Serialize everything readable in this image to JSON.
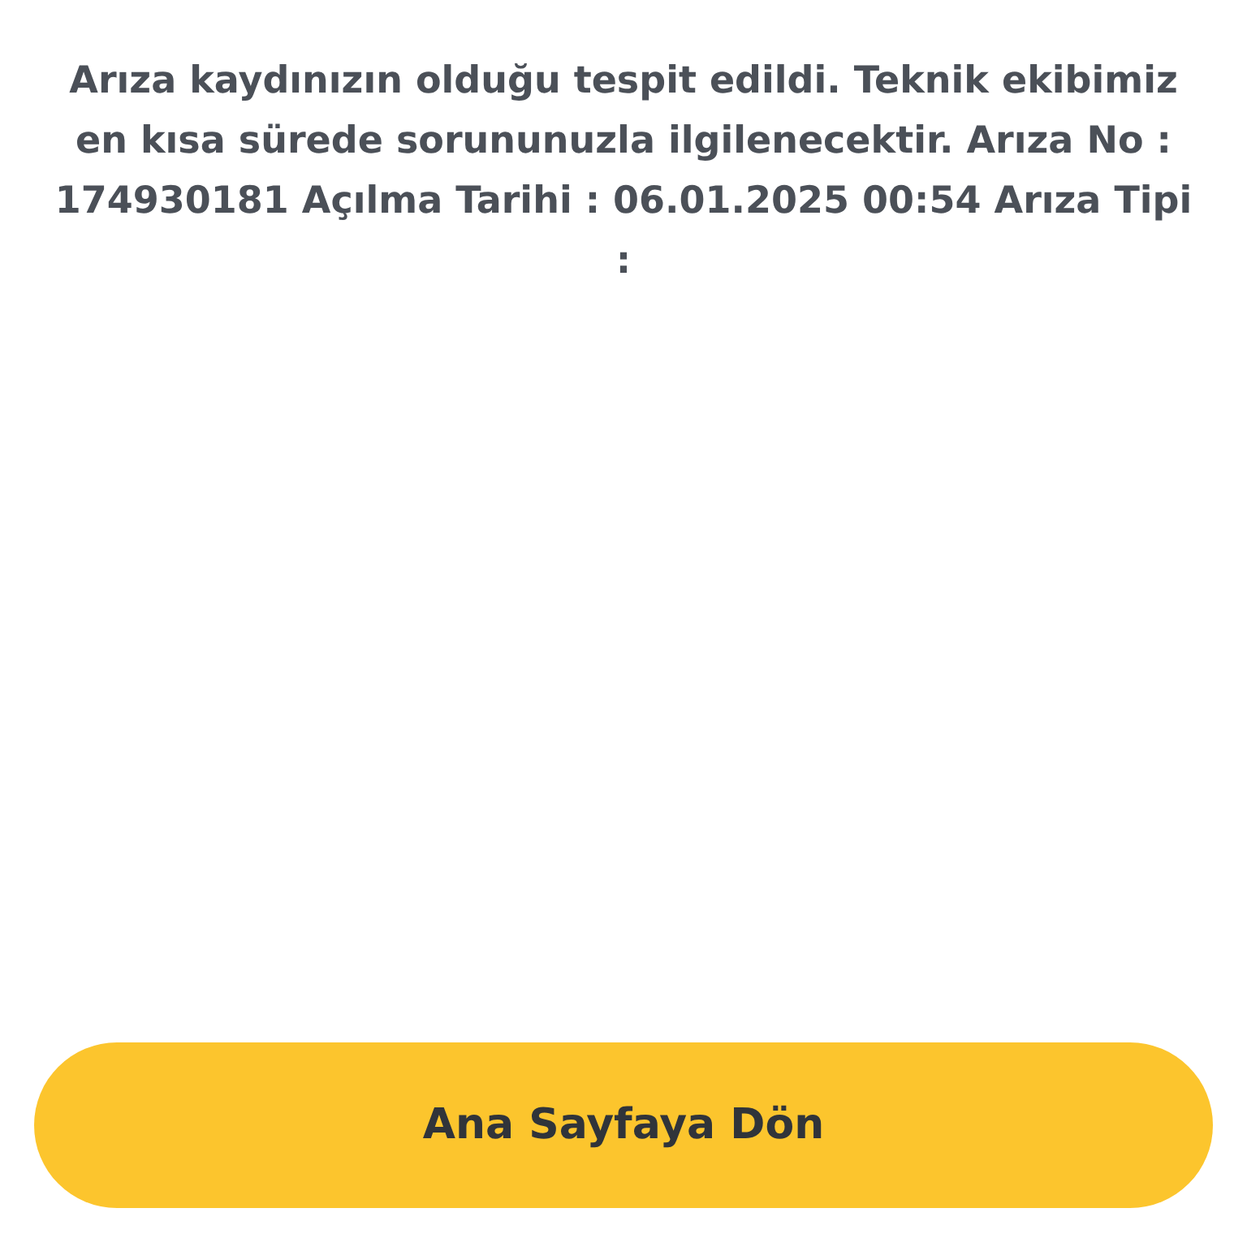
{
  "message": "Arıza kaydınızın olduğu tespit edildi. Teknik ekibimiz en kısa sürede sorununuzla ilgilenecektir. Arıza No : 174930181 Açılma Tarihi : 06.01.2025 00:54 Arıza Tipi :",
  "button": {
    "label": "Ana Sayfaya Dön"
  }
}
